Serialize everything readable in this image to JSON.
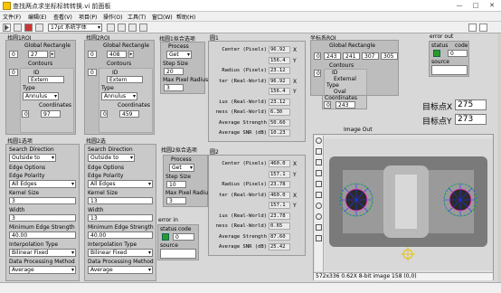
{
  "window": {
    "title": "查找两点求坐标标转转换.vi 前面板",
    "min": "—",
    "max": "□",
    "close": "✕"
  },
  "menu": [
    "文件(F)",
    "编辑(E)",
    "查看(V)",
    "项目(P)",
    "操作(O)",
    "工具(T)",
    "窗口(W)",
    "帮助(H)"
  ],
  "toolbar": {
    "font": "17pt 系统字体"
  },
  "roi1": {
    "title": "找圆1ROI",
    "global_label": "Global Rectangle",
    "idx": "0",
    "val": "27",
    "contours_label": "Contours",
    "contours_idx": "0",
    "id_label": "ID",
    "id_val": "Extern",
    "type_label": "Type",
    "type_val": "Annulus",
    "coords_label": "Coordinates",
    "coords_idx": "0",
    "coords_val": "97"
  },
  "roi2": {
    "title": "找圆2ROI",
    "global_label": "Global Rectangle",
    "idx": "0",
    "val": "408",
    "contours_label": "Contours",
    "contours_idx": "0",
    "id_label": "ID",
    "id_val": "Extern",
    "type_label": "Type",
    "type_val": "Annulus",
    "coords_label": "Coordinates",
    "coords_idx": "0",
    "coords_val": "459"
  },
  "circle1": {
    "title": "找圆1拟合选项",
    "process_label": "Process",
    "process_val": "Get",
    "step_label": "Step Size",
    "step_val": "20",
    "radius_label": "Max Pixel Radius",
    "radius_val": "3"
  },
  "circle2": {
    "title": "找圆2拟合选项",
    "process_label": "Process",
    "process_val": "Get",
    "step_label": "Step Size",
    "step_val": "10",
    "radius_label": "Max Pixel Radius",
    "radius_val": "3"
  },
  "fig1": {
    "title": "圆1",
    "rows": [
      {
        "label": "Center (Pixels)",
        "v": "96.92",
        "u": "X"
      },
      {
        "label": "",
        "v": "156.4",
        "u": "Y"
      },
      {
        "label": "Radius (Pixels)",
        "v": "23.12",
        "u": ""
      },
      {
        "label": "ter (Real-World)",
        "v": "96.92",
        "u": "X"
      },
      {
        "label": "",
        "v": "156.4",
        "u": "Y"
      },
      {
        "label": "ius (Real-World)",
        "v": "23.12",
        "u": ""
      },
      {
        "label": "ness (Real-World)",
        "v": "6.30",
        "u": ""
      },
      {
        "label": "Average Strength",
        "v": "50.60",
        "u": ""
      },
      {
        "label": "Average SNR (dB)",
        "v": "10.23",
        "u": ""
      }
    ]
  },
  "fig2": {
    "title": "圆2",
    "rows": [
      {
        "label": "Center (Pixels)",
        "v": "460.0",
        "u": "X"
      },
      {
        "label": "",
        "v": "157.1",
        "u": "Y"
      },
      {
        "label": "Radius (Pixels)",
        "v": "23.78",
        "u": ""
      },
      {
        "label": "ter (Real-World)",
        "v": "460.0",
        "u": "X"
      },
      {
        "label": "",
        "v": "157.1",
        "u": "Y"
      },
      {
        "label": "ius (Real-World)",
        "v": "23.78",
        "u": ""
      },
      {
        "label": "ness (Real-World)",
        "v": "0.65",
        "u": ""
      },
      {
        "label": "Average Strength",
        "v": "87.60",
        "u": ""
      },
      {
        "label": "Average SNR (dB)",
        "v": "25.42",
        "u": ""
      }
    ]
  },
  "cs": {
    "title": "坐标系ROI",
    "global_label": "Global Rectangle",
    "vals": [
      "243",
      "241",
      "307",
      "305"
    ],
    "idx": "0",
    "contours_label": "Contours",
    "contours_idx": "0",
    "id_label": "ID",
    "id_val": "External",
    "type_label": "Type",
    "type_val": "Oval",
    "coords_label": "Coordinates",
    "coords_idx": "0",
    "coords_val": "243"
  },
  "err_out": {
    "title": "error out",
    "status_label": "status",
    "code_label": "code",
    "code_val": "0",
    "source_label": "source"
  },
  "err_in": {
    "title": "error in",
    "status_label": "status",
    "code_label": "code",
    "code_val": "0",
    "source_label": "source"
  },
  "target": {
    "x_label": "目标点X",
    "x_val": "275",
    "y_label": "目标点Y",
    "y_val": "273"
  },
  "edge1": {
    "title": "找圆1选项",
    "search_label": "Search Direction",
    "search_val": "Outside to",
    "edge_label": "Edge Options",
    "polarity_label": "Edge Polarity",
    "polarity_val": "All Edges",
    "kernel_label": "Kernel Size",
    "kernel_val": "3",
    "width_label": "Width",
    "width_val": "3",
    "minstr_label": "Minimum Edge Strength",
    "minstr_val": "40.00",
    "interp_label": "Interpolation Type",
    "interp_val": "Bilinear Fixed",
    "dpm_label": "Data Processing Method",
    "dpm_val": "Average"
  },
  "edge2": {
    "title": "找圆2选",
    "search_label": "Search Direction",
    "search_val": "Outside to",
    "edge_label": "Edge Options",
    "polarity_label": "Edge Polarity",
    "polarity_val": "All Edges",
    "kernel_label": "Kernel Size",
    "kernel_val": "13",
    "width_label": "Width",
    "width_val": "13",
    "minstr_label": "Minimum Edge Strength",
    "minstr_val": "40.00",
    "interp_label": "Interpolation Type",
    "interp_val": "Bilinear Fixed",
    "dpm_label": "Data Processing Method",
    "dpm_val": "Average"
  },
  "image": {
    "title": "Image Out",
    "status": "572x336 0.62X 8-bit image 158     (0,0)"
  }
}
